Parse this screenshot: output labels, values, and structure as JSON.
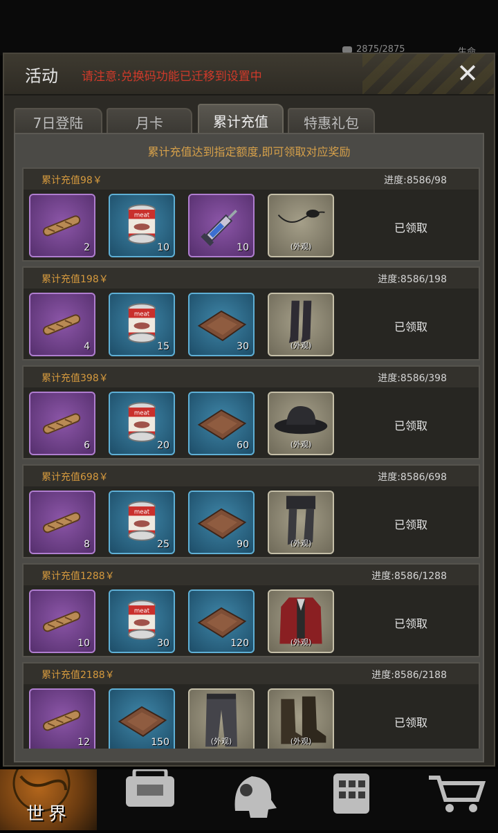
{
  "status": {
    "hp": "2875/2875",
    "life_label": "生命"
  },
  "dialog": {
    "title": "活动",
    "notice": "请注意:兑换码功能已迁移到设置中",
    "close_label": "✕"
  },
  "tabs": [
    {
      "label": "7日登陆",
      "active": false
    },
    {
      "label": "月卡",
      "active": false
    },
    {
      "label": "累计充值",
      "active": true
    },
    {
      "label": "特惠礼包",
      "active": false
    }
  ],
  "panel": {
    "description": "累计充值达到指定额度,即可领取对应奖励"
  },
  "rewards": [
    {
      "title": "累计充值98￥",
      "progress": "进度:8586/98",
      "status": "已领取",
      "items": [
        {
          "icon": "cigar-icon",
          "rarity": "purple",
          "qty": "2"
        },
        {
          "icon": "meat-can-icon",
          "rarity": "blue",
          "qty": "10"
        },
        {
          "icon": "syringe-icon",
          "rarity": "purple",
          "qty": "10"
        },
        {
          "icon": "eyepatch-icon",
          "rarity": "tan",
          "qty": "",
          "skin": "(外观)"
        }
      ]
    },
    {
      "title": "累计充值198￥",
      "progress": "进度:8586/198",
      "status": "已领取",
      "items": [
        {
          "icon": "cigar-icon",
          "rarity": "purple",
          "qty": "4"
        },
        {
          "icon": "meat-can-icon",
          "rarity": "blue",
          "qty": "15"
        },
        {
          "icon": "leather-tray-icon",
          "rarity": "blue",
          "qty": "30"
        },
        {
          "icon": "stockings-icon",
          "rarity": "tan",
          "qty": "",
          "skin": "(外观)"
        }
      ]
    },
    {
      "title": "累计充值398￥",
      "progress": "进度:8586/398",
      "status": "已领取",
      "items": [
        {
          "icon": "cigar-icon",
          "rarity": "purple",
          "qty": "6"
        },
        {
          "icon": "meat-can-icon",
          "rarity": "blue",
          "qty": "20"
        },
        {
          "icon": "leather-tray-icon",
          "rarity": "blue",
          "qty": "60"
        },
        {
          "icon": "hat-icon",
          "rarity": "tan",
          "qty": "",
          "skin": "(外观)"
        }
      ]
    },
    {
      "title": "累计充值698￥",
      "progress": "进度:8586/698",
      "status": "已领取",
      "items": [
        {
          "icon": "cigar-icon",
          "rarity": "purple",
          "qty": "8"
        },
        {
          "icon": "meat-can-icon",
          "rarity": "blue",
          "qty": "25"
        },
        {
          "icon": "leather-tray-icon",
          "rarity": "blue",
          "qty": "90"
        },
        {
          "icon": "shorts-stockings-icon",
          "rarity": "tan",
          "qty": "",
          "skin": "(外观)"
        }
      ]
    },
    {
      "title": "累计充值1288￥",
      "progress": "进度:8586/1288",
      "status": "已领取",
      "items": [
        {
          "icon": "cigar-icon",
          "rarity": "purple",
          "qty": "10"
        },
        {
          "icon": "meat-can-icon",
          "rarity": "blue",
          "qty": "30"
        },
        {
          "icon": "leather-tray-icon",
          "rarity": "blue",
          "qty": "120"
        },
        {
          "icon": "red-coat-icon",
          "rarity": "tan",
          "qty": "",
          "skin": "(外观)"
        }
      ]
    },
    {
      "title": "累计充值2188￥",
      "progress": "进度:8586/2188",
      "status": "已领取",
      "items": [
        {
          "icon": "cigar-icon",
          "rarity": "purple",
          "qty": "12"
        },
        {
          "icon": "leather-tray-icon",
          "rarity": "blue",
          "qty": "150"
        },
        {
          "icon": "pants-icon",
          "rarity": "tan",
          "qty": "",
          "skin": "(外观)"
        },
        {
          "icon": "boots-icon",
          "rarity": "tan",
          "qty": "",
          "skin": "(外观)"
        }
      ]
    }
  ],
  "bottom_nav": {
    "world_label": "世界",
    "items": [
      "world-globe-icon",
      "backpack-icon",
      "head-gear-icon",
      "building-icon",
      "cart-icon"
    ]
  }
}
